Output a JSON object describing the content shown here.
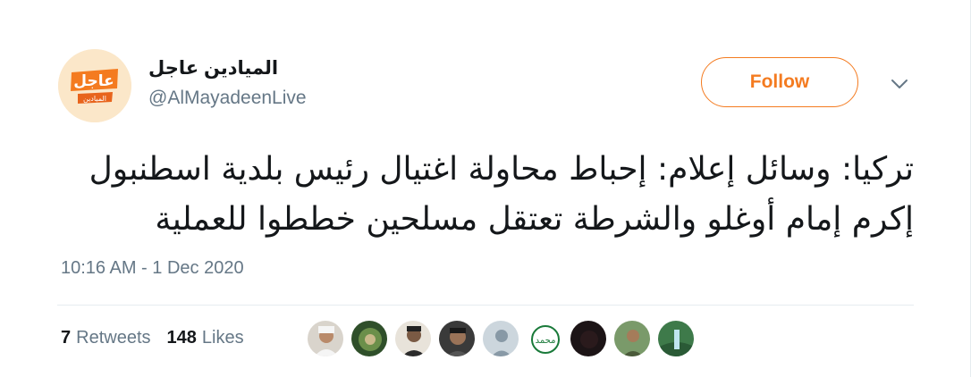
{
  "user": {
    "display_name": "الميادين عاجل",
    "handle": "@AlMayadeenLive",
    "avatar_text_top": "عاجل",
    "avatar_text_bottom": "الميادين"
  },
  "follow_label": "Follow",
  "tweet": {
    "line1": "تركيا: وسائل إعلام: إحباط محاولة اغتيال رئيس بلدية اسطنبول",
    "line2": "إكرم إمام أوغلو والشرطة تعتقل مسلحين خططوا للعملية"
  },
  "timestamp": "10:16 AM - 1 Dec 2020",
  "stats": {
    "retweets_count": "7",
    "retweets_label": "Retweets",
    "likes_count": "148",
    "likes_label": "Likes"
  },
  "colors": {
    "accent": "#f47b20",
    "muted": "#657786",
    "text": "#14171a",
    "divider": "#e6ecf0"
  },
  "icons": {
    "caret": "chevron-down-icon"
  }
}
